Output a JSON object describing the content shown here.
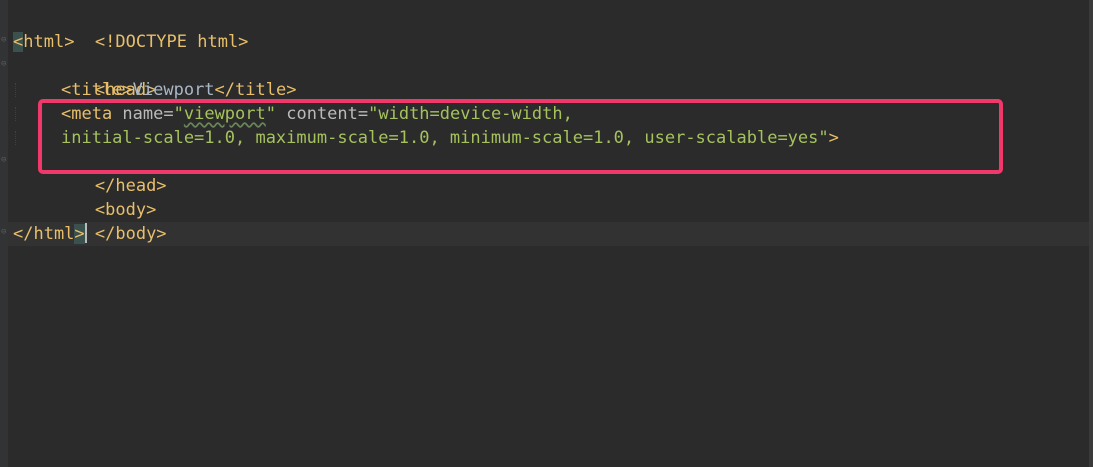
{
  "editor": {
    "lines": [
      {
        "parts": [
          {
            "cls": "tag",
            "text": "<!DOCTYPE html>"
          }
        ]
      },
      {
        "parts": [
          {
            "cls": "tag hl",
            "text": "<"
          },
          {
            "cls": "tag",
            "text": "html>"
          }
        ]
      },
      {
        "parts": [
          {
            "cls": "tag",
            "text": "<head>"
          }
        ]
      },
      {
        "parts": [
          {
            "cls": "tag",
            "text": "<title>"
          },
          {
            "cls": "txt",
            "text": "Viewport"
          },
          {
            "cls": "tag",
            "text": "</title>"
          }
        ]
      },
      {
        "parts": [
          {
            "cls": "tag",
            "text": "<meta "
          },
          {
            "cls": "attr",
            "text": "name="
          },
          {
            "cls": "str",
            "text": "\""
          },
          {
            "cls": "str squiggle",
            "text": "viewport"
          },
          {
            "cls": "str",
            "text": "\" "
          },
          {
            "cls": "attr",
            "text": "content="
          },
          {
            "cls": "str",
            "text": "\"width=device-width,"
          }
        ]
      },
      {
        "parts": [
          {
            "cls": "str",
            "text": "initial-scale=1.0, maximum-scale=1.0, minimum-scale=1.0, user-scalable=yes\""
          },
          {
            "cls": "tag",
            "text": ">"
          }
        ]
      },
      {
        "parts": [
          {
            "cls": "tag",
            "text": "</head>"
          }
        ]
      },
      {
        "parts": [
          {
            "cls": "tag",
            "text": "<body>"
          }
        ]
      },
      {
        "parts": [
          {
            "cls": "tag",
            "text": "</body>"
          }
        ]
      },
      {
        "parts": [
          {
            "cls": "tag",
            "text": "</html"
          },
          {
            "cls": "tag hl",
            "text": ">"
          }
        ]
      }
    ],
    "colors": {
      "background": "#2b2b2b",
      "tag": "#e8bf6a",
      "attribute": "#bababa",
      "string": "#a5c25c",
      "text": "#a9b7c6",
      "highlight_border": "#f0386b"
    }
  }
}
